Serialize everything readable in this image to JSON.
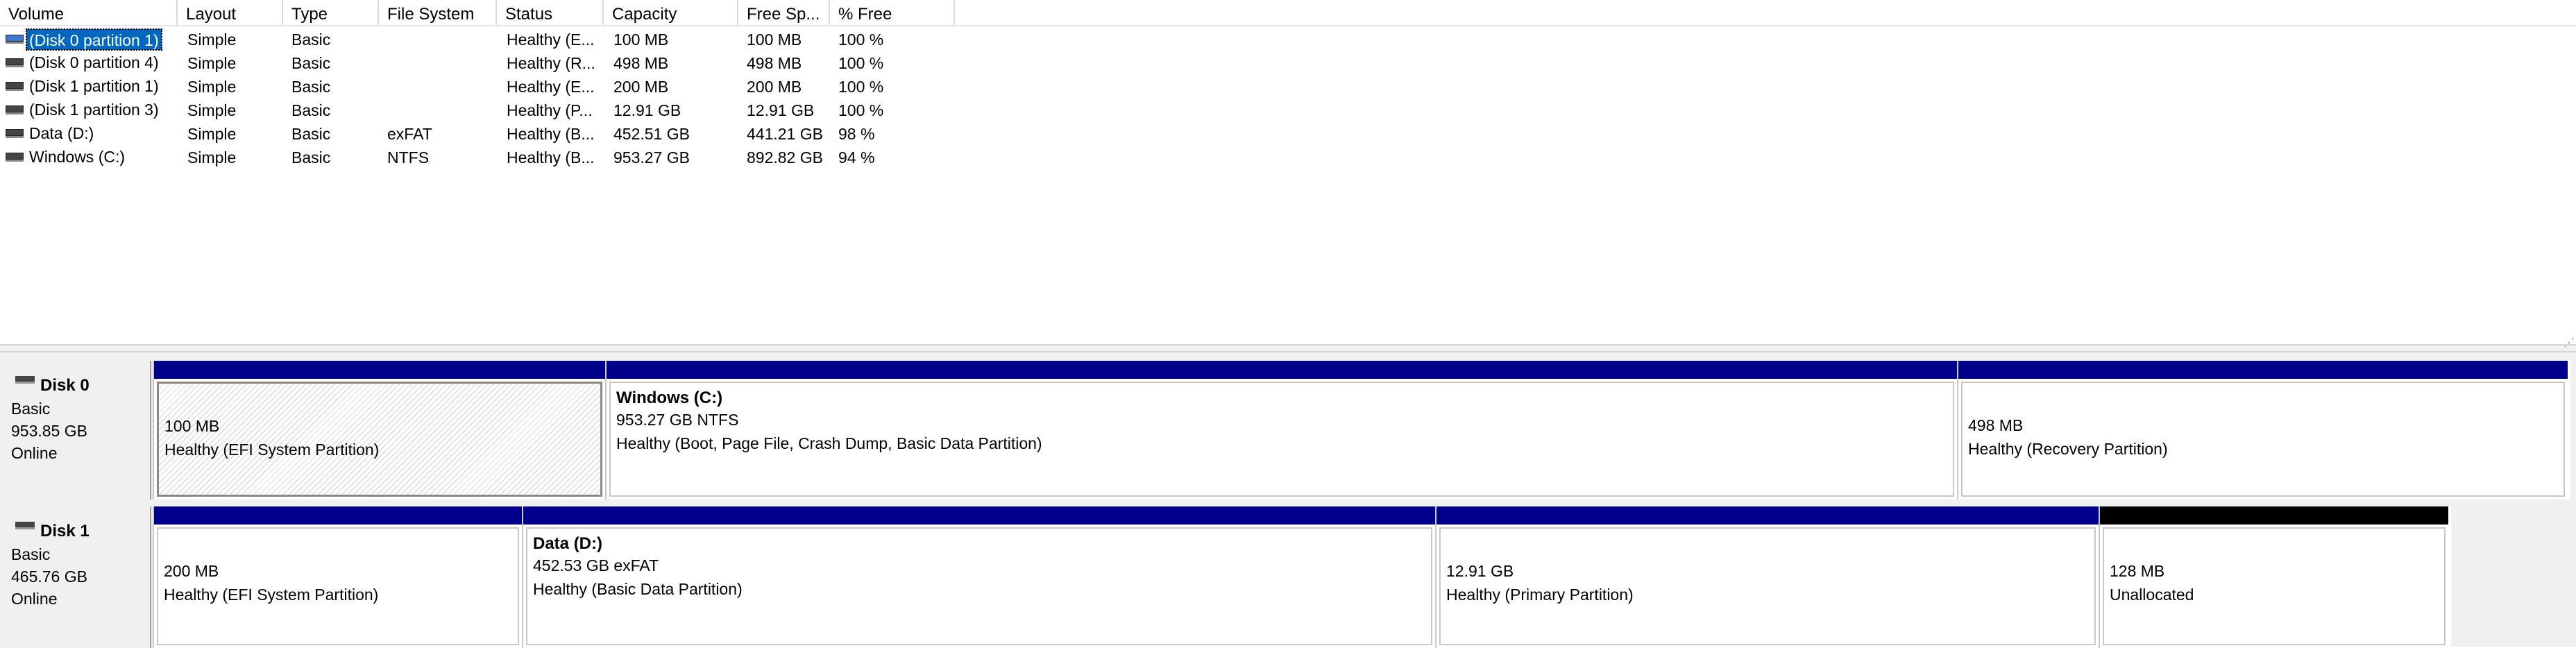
{
  "columns": [
    "Volume",
    "Layout",
    "Type",
    "File System",
    "Status",
    "Capacity",
    "Free Sp...",
    "% Free"
  ],
  "volumes": [
    {
      "name": "(Disk 0 partition 1)",
      "layout": "Simple",
      "type": "Basic",
      "fs": "",
      "status": "Healthy (E...",
      "capacity": "100 MB",
      "free": "100 MB",
      "pct": "100 %",
      "selected": true
    },
    {
      "name": "(Disk 0 partition 4)",
      "layout": "Simple",
      "type": "Basic",
      "fs": "",
      "status": "Healthy (R...",
      "capacity": "498 MB",
      "free": "498 MB",
      "pct": "100 %"
    },
    {
      "name": "(Disk 1 partition 1)",
      "layout": "Simple",
      "type": "Basic",
      "fs": "",
      "status": "Healthy (E...",
      "capacity": "200 MB",
      "free": "200 MB",
      "pct": "100 %"
    },
    {
      "name": "(Disk 1 partition 3)",
      "layout": "Simple",
      "type": "Basic",
      "fs": "",
      "status": "Healthy (P...",
      "capacity": "12.91 GB",
      "free": "12.91 GB",
      "pct": "100 %"
    },
    {
      "name": "Data (D:)",
      "layout": "Simple",
      "type": "Basic",
      "fs": "exFAT",
      "status": "Healthy (B...",
      "capacity": "452.51 GB",
      "free": "441.21 GB",
      "pct": "98 %"
    },
    {
      "name": "Windows (C:)",
      "layout": "Simple",
      "type": "Basic",
      "fs": "NTFS",
      "status": "Healthy (B...",
      "capacity": "953.27 GB",
      "free": "892.82 GB",
      "pct": "94 %"
    }
  ],
  "disks": [
    {
      "name": "Disk 0",
      "type": "Basic",
      "size": "953.85 GB",
      "state": "Online",
      "partitions": [
        {
          "title": "",
          "size": "100 MB",
          "status": "Healthy (EFI System Partition)",
          "hatched": true
        },
        {
          "title": "Windows  (C:)",
          "size": "953.27 GB NTFS",
          "status": "Healthy (Boot, Page File, Crash Dump, Basic Data Partition)"
        },
        {
          "title": "",
          "size": "498 MB",
          "status": "Healthy (Recovery Partition)"
        }
      ]
    },
    {
      "name": "Disk 1",
      "type": "Basic",
      "size": "465.76 GB",
      "state": "Online",
      "partitions": [
        {
          "title": "",
          "size": "200 MB",
          "status": "Healthy (EFI System Partition)"
        },
        {
          "title": "Data  (D:)",
          "size": "452.53 GB exFAT",
          "status": "Healthy (Basic Data Partition)"
        },
        {
          "title": "",
          "size": "12.91 GB",
          "status": "Healthy (Primary Partition)"
        },
        {
          "title": "",
          "size": "128 MB",
          "status": "Unallocated",
          "unallocated": true
        }
      ]
    }
  ],
  "colors": {
    "primary_bar": "#00008b",
    "unallocated_bar": "#000000",
    "selection": "#0067c0"
  }
}
